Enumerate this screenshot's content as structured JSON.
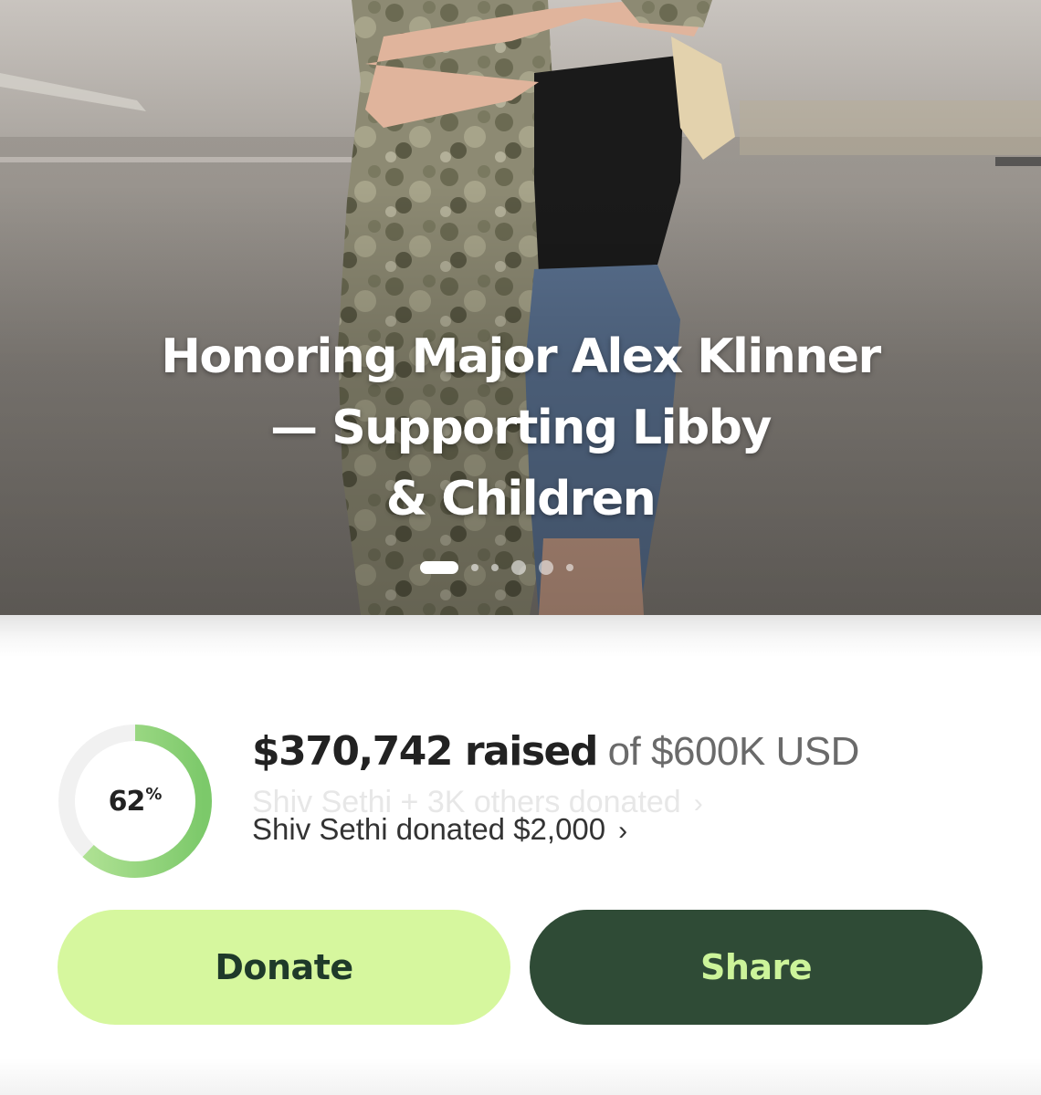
{
  "hero": {
    "title_lines": [
      "Honoring Major Alex Klinner",
      "— Supporting Libby",
      "& Children"
    ],
    "photo_description_icon": "hero-photo",
    "carousel_total": 6,
    "carousel_active_index": 0
  },
  "progress": {
    "percent_number": "62",
    "percent_sign": "%",
    "fraction": 0.62,
    "raised_amount": "$370,742 raised",
    "goal_text": "of $600K USD",
    "donor_ticker_previous": "Shiv Sethi + 3K others donated",
    "donor_ticker_current": "Shiv Sethi donated $2,000",
    "chevron": "›"
  },
  "actions": {
    "donate_label": "Donate",
    "share_label": "Share"
  },
  "colors": {
    "accent_green": "#8fd36a",
    "donate_bg": "#d6f79e",
    "share_bg": "#2f4b36",
    "share_text": "#ccf49a"
  }
}
